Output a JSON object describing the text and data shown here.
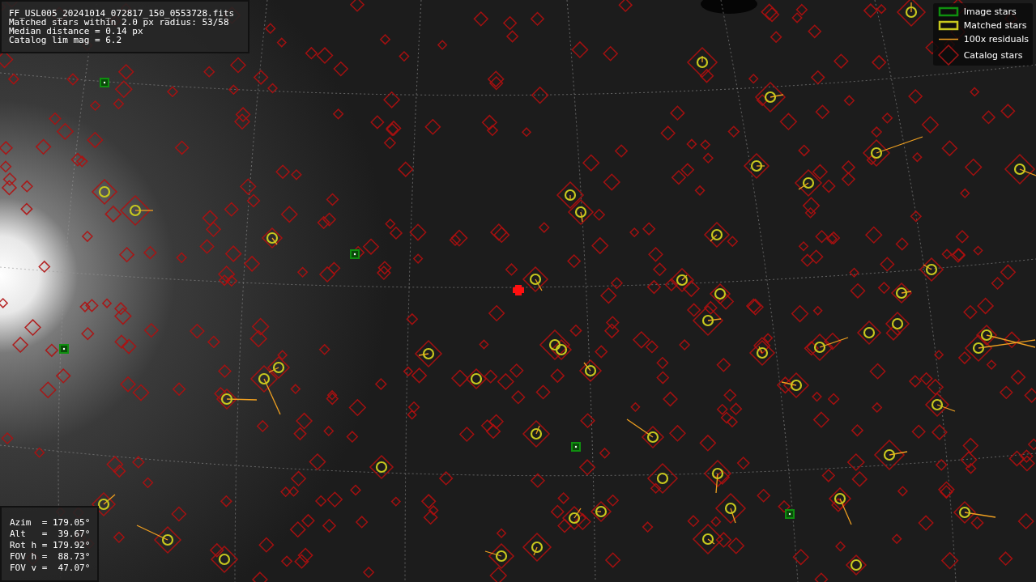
{
  "info_box": {
    "lines": [
      "FF_USL005_20241014_072817_150_0553728.fits",
      "Matched stars within 2.0 px radius: 53/58",
      "Median distance = 0.14 px",
      "Catalog lim mag = 6.2"
    ]
  },
  "legend": {
    "items": [
      {
        "kind": "image",
        "label": "Image stars"
      },
      {
        "kind": "matched",
        "label": "Matched stars"
      },
      {
        "kind": "residual",
        "label": "100x residuals"
      },
      {
        "kind": "catalog",
        "label": "Catalog stars"
      }
    ]
  },
  "pointing_box": {
    "lines": [
      "Azim  = 179.05°",
      "Alt   =  39.67°",
      "Rot h = 179.92°",
      "FOV h =  88.73°",
      "FOV v =  47.07°"
    ]
  }
}
